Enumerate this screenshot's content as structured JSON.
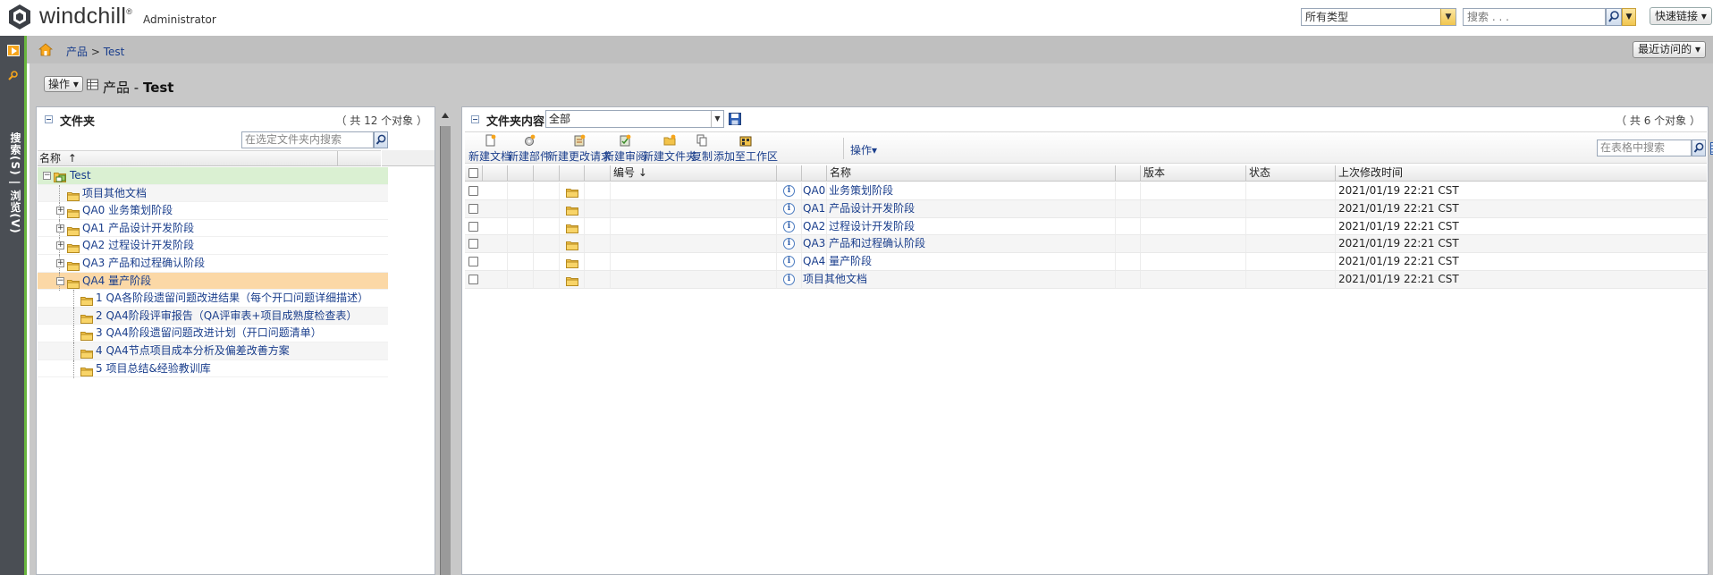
{
  "header": {
    "brand": "windchill",
    "brand_mark": "®",
    "role": "Administrator",
    "type_select_value": "所有类型",
    "search_placeholder": "搜索 . . .",
    "quick_links_label": "快速链接"
  },
  "nav": {
    "vertical_label": "搜索(S) | 浏览(V)"
  },
  "breadcrumb": {
    "root": "产品",
    "separator": " > ",
    "current": "Test",
    "recent_label": "最近访问的"
  },
  "page": {
    "actions_label": "操作",
    "title_prefix": "产品 - ",
    "title_name": "Test"
  },
  "folders_panel": {
    "title": "文件夹",
    "count": "（ 共 12 个对象 ）",
    "search_placeholder": "在选定文件夹内搜索",
    "column_name": "名称",
    "sort_indicator": "↑",
    "tree": [
      {
        "label": "Test",
        "level": 0,
        "toggle": "−",
        "state": "root",
        "icon": "product-icon"
      },
      {
        "label": "项目其他文档",
        "level": 1,
        "toggle": "",
        "state": "alt",
        "icon": "folder-icon"
      },
      {
        "label": "QA0 业务策划阶段",
        "level": 1,
        "toggle": "+",
        "state": "",
        "icon": "folder-icon"
      },
      {
        "label": "QA1 产品设计开发阶段",
        "level": 1,
        "toggle": "+",
        "state": "",
        "icon": "folder-icon"
      },
      {
        "label": "QA2 过程设计开发阶段",
        "level": 1,
        "toggle": "+",
        "state": "",
        "icon": "folder-icon"
      },
      {
        "label": "QA3 产品和过程确认阶段",
        "level": 1,
        "toggle": "+",
        "state": "",
        "icon": "folder-icon"
      },
      {
        "label": "QA4 量产阶段",
        "level": 1,
        "toggle": "−",
        "state": "sel",
        "icon": "folder-icon"
      },
      {
        "label": "1 QA各阶段遗留问题改进结果（每个开口问题详细描述）",
        "level": 2,
        "toggle": "",
        "state": "",
        "icon": "folder-icon"
      },
      {
        "label": "2 QA4阶段评审报告（QA评审表+项目成熟度检查表）",
        "level": 2,
        "toggle": "",
        "state": "alt",
        "icon": "folder-icon"
      },
      {
        "label": "3 QA4阶段遗留问题改进计划（开口问题清单）",
        "level": 2,
        "toggle": "",
        "state": "",
        "icon": "folder-icon"
      },
      {
        "label": "4 QA4节点项目成本分析及偏差改善方案",
        "level": 2,
        "toggle": "",
        "state": "alt",
        "icon": "folder-icon"
      },
      {
        "label": "5 项目总结&经验教训库",
        "level": 2,
        "toggle": "",
        "state": "",
        "icon": "folder-icon"
      }
    ]
  },
  "contents_panel": {
    "title": "文件夹内容",
    "filter_value": "全部",
    "count": "（ 共 6 个对象 ）",
    "toolbar": {
      "new_document": "新建文档",
      "new_part": "新建部件",
      "new_change_request": "新建更改请求",
      "new_review": "新建审阅",
      "new_folder": "新建文件夹",
      "copy": "复制",
      "add_to_workspace": "添加至工作区",
      "actions": "操作"
    },
    "table_search_placeholder": "在表格中搜索",
    "help_label": "?",
    "columns": {
      "number": "编号",
      "number_sort": "↓",
      "name": "名称",
      "version": "版本",
      "state": "状态",
      "modified": "上次修改时间"
    },
    "rows": [
      {
        "name": "QA0 业务策划阶段",
        "modified": "2021/01/19 22:21 CST"
      },
      {
        "name": "QA1 产品设计开发阶段",
        "modified": "2021/01/19 22:21 CST"
      },
      {
        "name": "QA2 过程设计开发阶段",
        "modified": "2021/01/19 22:21 CST"
      },
      {
        "name": "QA3 产品和过程确认阶段",
        "modified": "2021/01/19 22:21 CST"
      },
      {
        "name": "QA4 量产阶段",
        "modified": "2021/01/19 22:21 CST"
      },
      {
        "name": "项目其他文档",
        "modified": "2021/01/19 22:21 CST"
      }
    ]
  },
  "colors": {
    "accent_green": "#69b53e",
    "nav_dark": "#4a4e54",
    "folder_yellow": "#f3c34a",
    "selected_row": "#fbd8a6",
    "root_row": "#daf0d2",
    "link_blue": "#1a3e8c"
  }
}
